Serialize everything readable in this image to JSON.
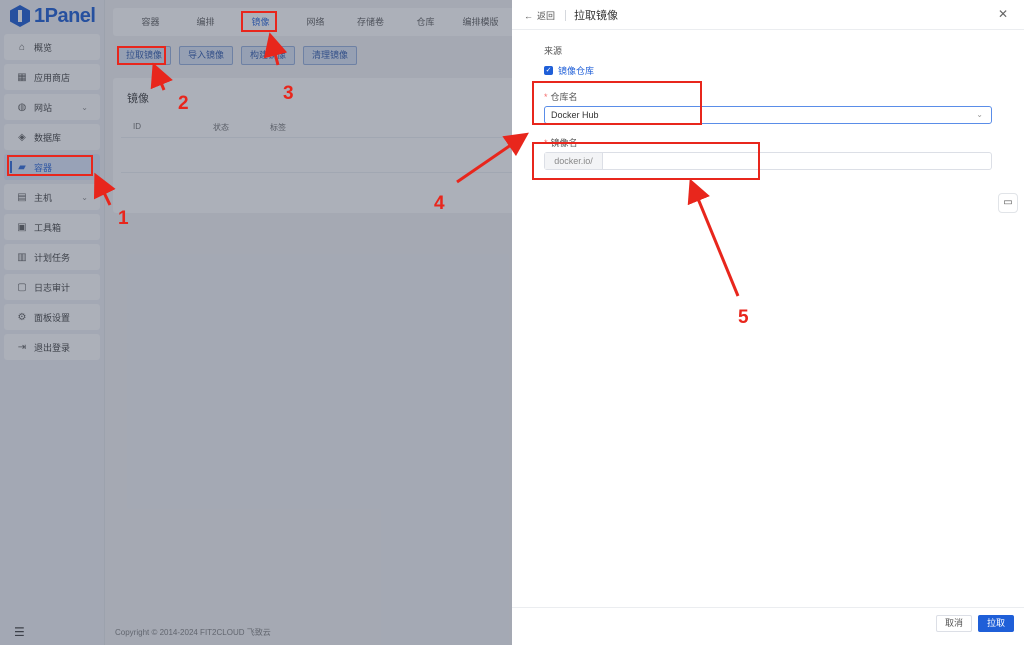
{
  "app": {
    "logo_text": "1Panel"
  },
  "sidebar": {
    "items": [
      {
        "label": "概览",
        "icon": "home-icon"
      },
      {
        "label": "应用商店",
        "icon": "grid-icon"
      },
      {
        "label": "网站",
        "icon": "globe-icon",
        "has_children": true
      },
      {
        "label": "数据库",
        "icon": "layers-icon"
      },
      {
        "label": "容器",
        "icon": "docker-icon",
        "active": true
      },
      {
        "label": "主机",
        "icon": "server-icon",
        "has_children": true
      },
      {
        "label": "工具箱",
        "icon": "toolbox-icon"
      },
      {
        "label": "计划任务",
        "icon": "calendar-icon"
      },
      {
        "label": "日志审计",
        "icon": "log-icon"
      },
      {
        "label": "面板设置",
        "icon": "gear-icon"
      },
      {
        "label": "退出登录",
        "icon": "logout-icon"
      }
    ]
  },
  "main": {
    "tabs": [
      "容器",
      "编排",
      "镜像",
      "网络",
      "存储卷",
      "仓库",
      "编排模版"
    ],
    "active_tab": "镜像",
    "buttons": [
      "拉取镜像",
      "导入镜像",
      "构建镜像",
      "清理镜像"
    ],
    "card_title": "镜像",
    "columns": [
      "ID",
      "状态",
      "标签"
    ],
    "footer": "Copyright © 2014-2024 FIT2CLOUD 飞致云"
  },
  "drawer": {
    "back_label": "返回",
    "title": "拉取镜像",
    "source_label": "来源",
    "checkbox_label": "镜像仓库",
    "repo_label": "仓库名",
    "repo_value": "Docker Hub",
    "image_label": "镜像名",
    "image_prefix": "docker.io/",
    "image_value": "",
    "cancel_label": "取消",
    "confirm_label": "拉取"
  },
  "annotations": [
    "1",
    "2",
    "3",
    "4",
    "5"
  ],
  "colors": {
    "accent": "#1f5fd8",
    "annotation": "#e8261c"
  }
}
